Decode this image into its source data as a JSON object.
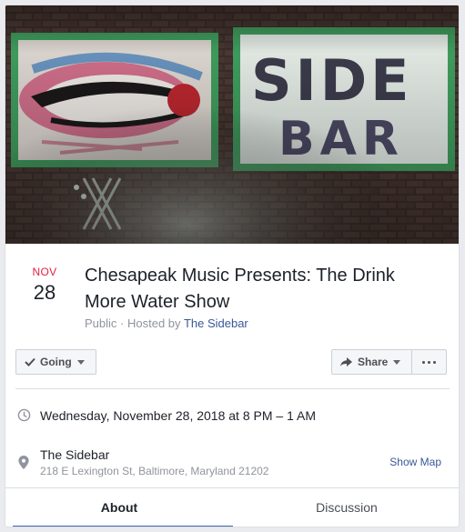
{
  "event": {
    "month": "NOV",
    "day": "28",
    "title": "Chesapeak Music Presents: The Drink More Water Show",
    "privacy": "Public",
    "hosted_by_prefix": "Hosted by",
    "host": "The Sidebar"
  },
  "actions": {
    "going_label": "Going",
    "share_label": "Share"
  },
  "details": {
    "datetime": "Wednesday, November 28, 2018 at 8 PM – 1 AM",
    "venue_name": "The Sidebar",
    "venue_address": "218 E Lexington St, Baltimore, Maryland 21202",
    "show_map_label": "Show Map"
  },
  "tabs": [
    {
      "label": "About",
      "active": true
    },
    {
      "label": "Discussion",
      "active": false
    }
  ],
  "colors": {
    "accent": "#4267b2",
    "date_month": "#e41e3f",
    "link": "#385898"
  },
  "icons": [
    "check-icon",
    "caret-down-icon",
    "share-arrow-icon",
    "more-dots-icon",
    "clock-icon",
    "map-pin-icon"
  ]
}
